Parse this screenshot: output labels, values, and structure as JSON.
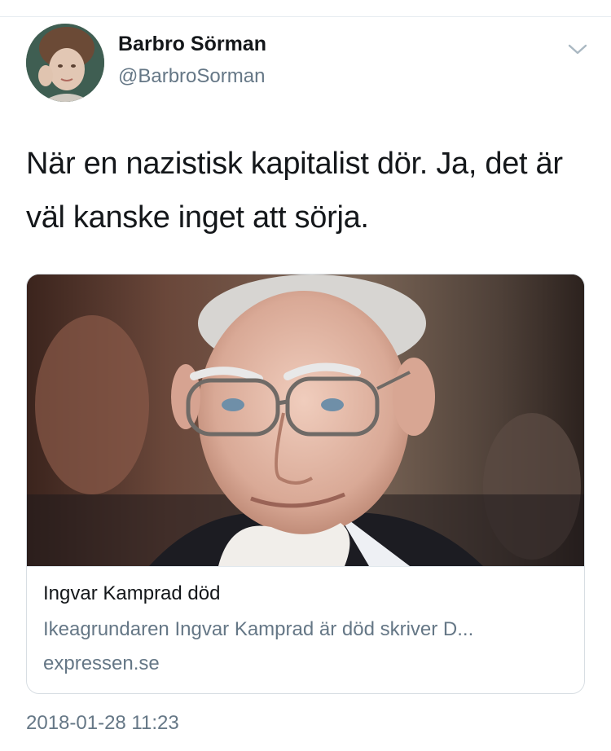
{
  "tweet": {
    "author": {
      "name": "Barbro Sörman",
      "handle": "@BarbroSorman"
    },
    "text": "När en nazistisk kapitalist dör. Ja, det är väl kanske inget att sörja.",
    "menu_icon": "chevron-down-icon",
    "card": {
      "title": "Ingvar Kamprad död",
      "description": "Ikeagrundaren Ingvar Kamprad är död skriver D...",
      "domain": "expressen.se"
    },
    "timestamp": "2018-01-28 11:23"
  }
}
